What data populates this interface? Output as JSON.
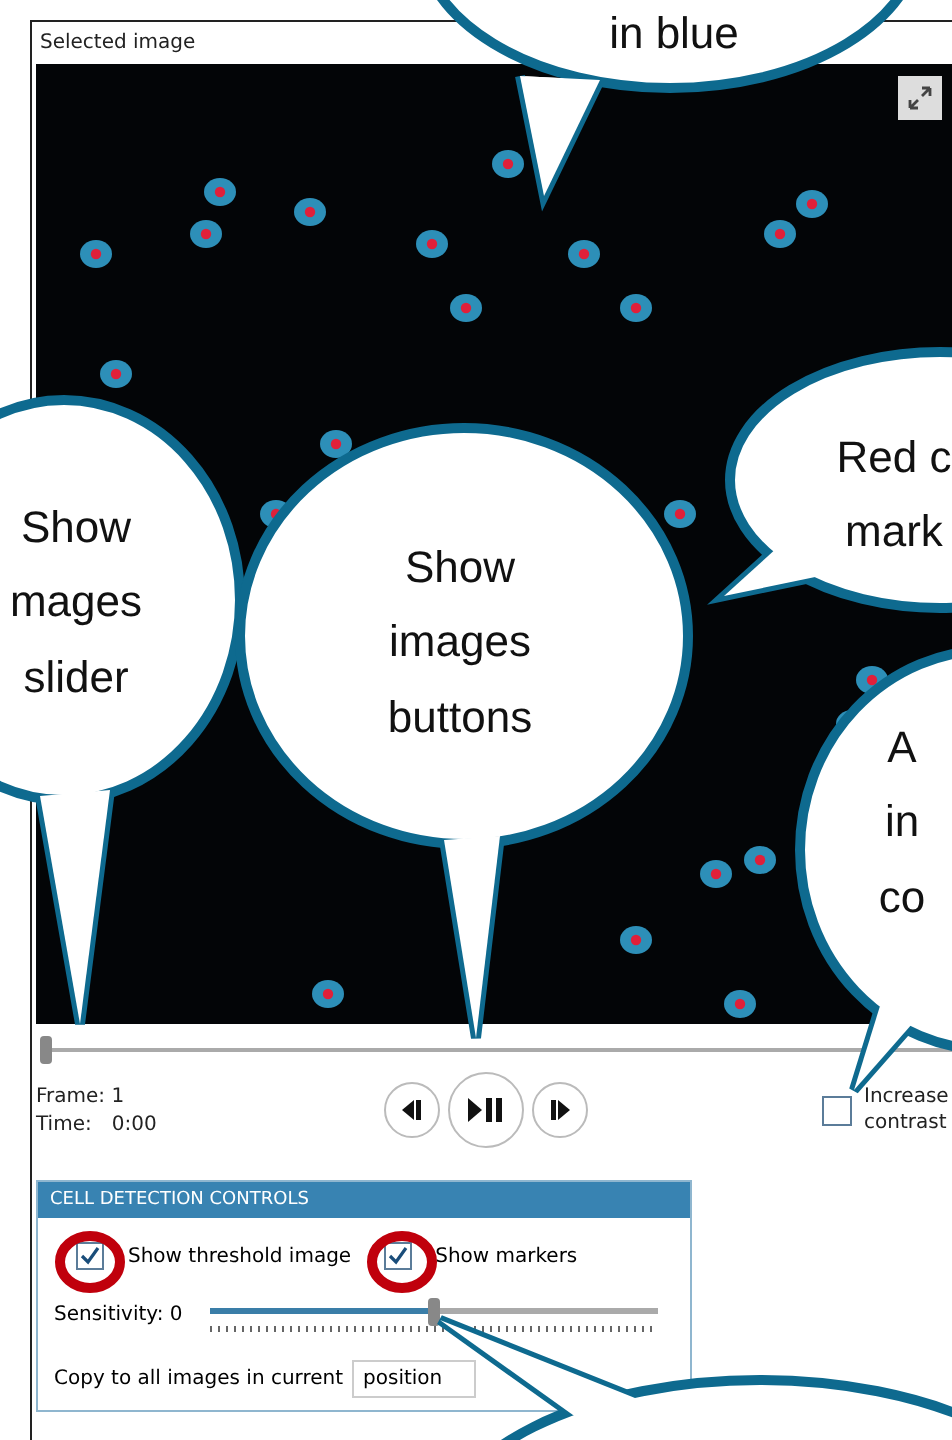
{
  "panel": {
    "title": "Selected image"
  },
  "frame_slider": {
    "level": 0
  },
  "frame": "Frame: 1",
  "time_label": "Time:",
  "time": "0:00",
  "playback_buttons": [
    {
      "kind": "previous"
    },
    {
      "kind": "play_pause"
    },
    {
      "kind": "next"
    }
  ],
  "increase_contrast": {
    "label": "Increase contrast",
    "checked": false
  },
  "cell_detection": {
    "title": "CELL DETECTION CONTROLS",
    "checkboxes": [
      {
        "label": "Show threshold image",
        "checked": true
      },
      {
        "label": "Show markers",
        "checked": true
      }
    ],
    "sensitivity": {
      "label": "Sensitivity: 0",
      "level": 0.5
    },
    "copy_label": "Copy to all images in current",
    "copy_value": "position"
  },
  "callouts": [
    {
      "lines": [
        "in blue"
      ]
    },
    {
      "lines": [
        "Show",
        "mages",
        "slider"
      ]
    },
    {
      "lines": [
        "Show",
        "images",
        "buttons"
      ]
    },
    {
      "lines": [
        "Red c",
        "mark"
      ]
    },
    {
      "lines": [
        "A",
        "in",
        "co"
      ]
    }
  ]
}
